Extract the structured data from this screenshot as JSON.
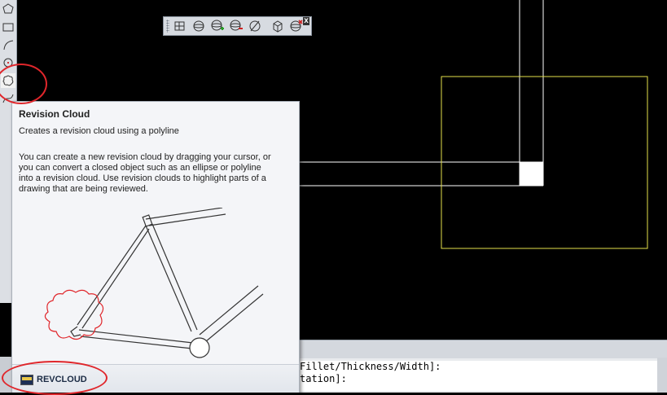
{
  "tooltip": {
    "title": "Revision Cloud",
    "subtitle": "Creates a revision cloud using a polyline",
    "body_lines": [
      "You can create a new revision cloud by dragging your cursor, or",
      "you can convert a closed object such as an ellipse or polyline",
      "into a revision cloud. Use revision clouds to highlight parts of a",
      "drawing that are being reviewed."
    ],
    "command": "REVCLOUD"
  },
  "command_line": {
    "lines": [
      "Fillet/Thickness/Width]:",
      "tation]:"
    ]
  },
  "floating_toolbar": {
    "close_label": "x",
    "icons": [
      "box-grid-icon",
      "sphere-icon",
      "sphere-add-icon",
      "sphere-remove-icon",
      "sphere-slash-icon",
      "cube-icon",
      "sphere-close-icon"
    ]
  },
  "left_toolbar": {
    "icons": [
      "polygon-icon",
      "rectangle-icon",
      "arc-icon",
      "circle-icon",
      "revision-cloud-icon"
    ]
  },
  "colors": {
    "canvas": "#000000",
    "highlight_rect": "#e5e04a",
    "annotation_circle": "#e0262b"
  }
}
